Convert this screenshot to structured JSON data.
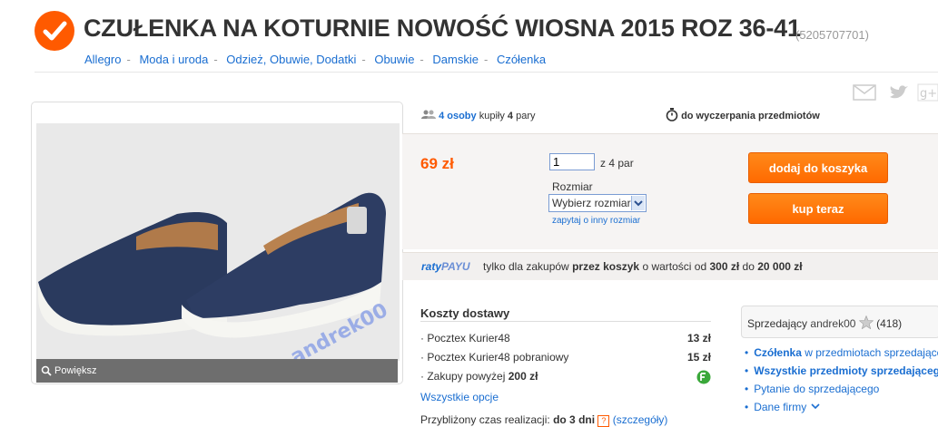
{
  "header": {
    "title": "CZUŁENKA NA KOTURNIE NOWOŚĆ WIOSNA 2015 ROZ 36-41",
    "item_id": "(5205707701)"
  },
  "breadcrumb": [
    "Allegro",
    "Moda i uroda",
    "Odzież, Obuwie, Dodatki",
    "Obuwie",
    "Damskie",
    "Czółenka"
  ],
  "gallery": {
    "zoom_label": "Powiększ",
    "watermark": "andrek00"
  },
  "info": {
    "buyers_count": "4 osoby",
    "buyers_text": "kupiły",
    "buyers_qty": "4",
    "buyers_unit": "pary",
    "availability": "do wyczerpania przedmiotów"
  },
  "purchase": {
    "price": "69 zł",
    "quantity": "1",
    "quantity_of": "z 4 par",
    "size_label": "Rozmiar",
    "size_selected": "Wybierz rozmiar",
    "ask_size": "zapytaj o inny rozmiar",
    "cart_button": "dodaj do koszyka",
    "buy_button": "kup teraz"
  },
  "installments": {
    "logo_a": "raty",
    "logo_b": "PAYU",
    "t1": "tylko dla zakupów",
    "t2": "przez koszyk",
    "t3": "o wartości od",
    "t4": "300 zł",
    "t5": "do",
    "t6": "20 000 zł"
  },
  "shipping": {
    "title": "Koszty dostawy",
    "rows": [
      {
        "name": "Pocztex Kurier48",
        "price": "13 zł"
      },
      {
        "name": "Pocztex Kurier48 pobraniowy",
        "price": "15 zł"
      },
      {
        "name": "Zakupy powyżej",
        "bold": "200 zł"
      }
    ],
    "all_options": "Wszystkie opcje",
    "realization_label": "Przybliżony czas realizacji:",
    "realization_value": "do 3 dni",
    "details": "(szczegóły)"
  },
  "seller": {
    "label": "Sprzedający",
    "name": "andrek00",
    "rating": "(418)",
    "links": [
      {
        "bold": "Czółenka",
        "rest": "w przedmiotach sprzedającego"
      },
      {
        "bold": "Wszystkie przedmioty sprzedającego",
        "rest": ""
      },
      {
        "bold": "",
        "rest": "Pytanie do sprzedającego"
      },
      {
        "bold": "",
        "rest": "Dane firmy"
      }
    ]
  },
  "colors": {
    "accent": "#ff5a00",
    "link": "#1a6ed1"
  }
}
